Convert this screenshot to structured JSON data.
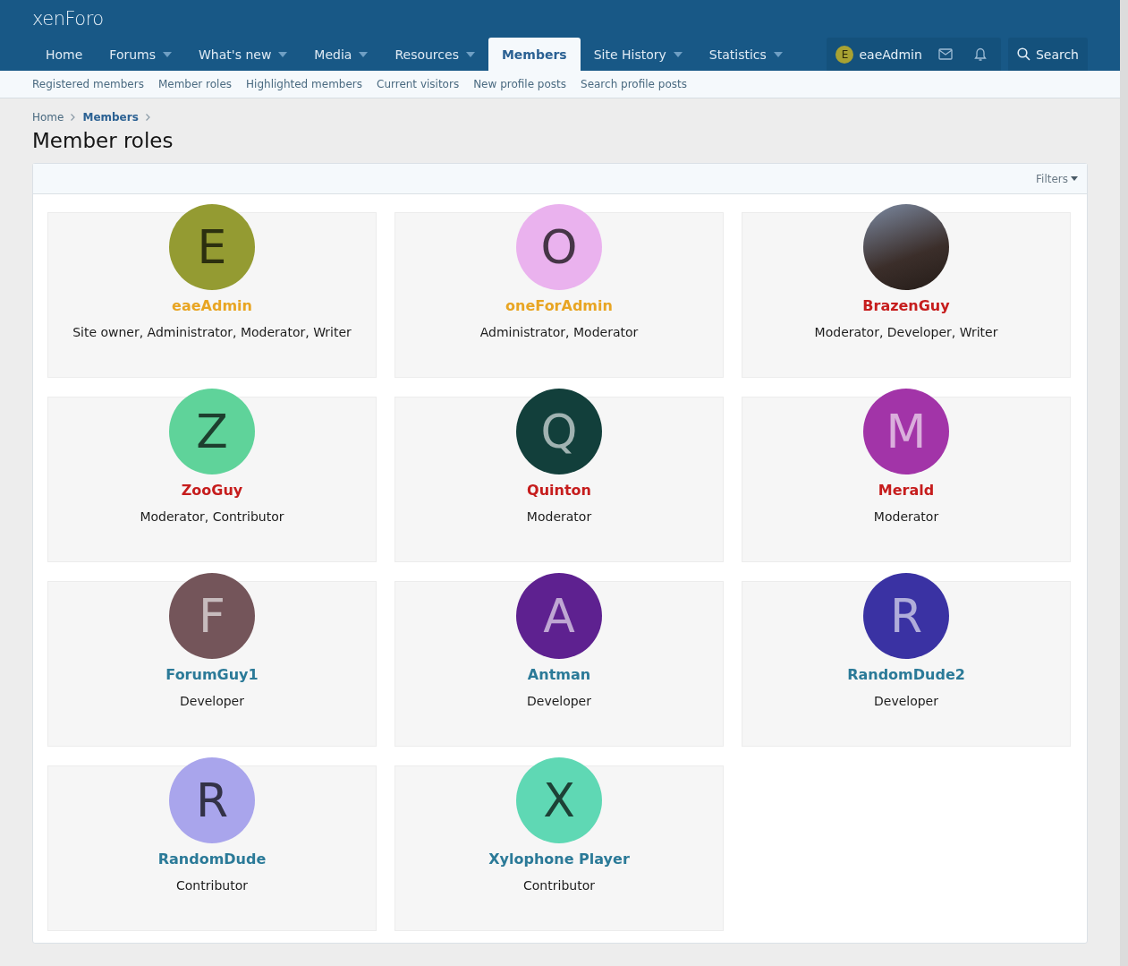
{
  "logo": "xenForo",
  "nav": [
    {
      "label": "Home",
      "dropdown": false,
      "selected": false
    },
    {
      "label": "Forums",
      "dropdown": true,
      "selected": false
    },
    {
      "label": "What's new",
      "dropdown": true,
      "selected": false
    },
    {
      "label": "Media",
      "dropdown": true,
      "selected": false
    },
    {
      "label": "Resources",
      "dropdown": true,
      "selected": false
    },
    {
      "label": "Members",
      "dropdown": false,
      "selected": true
    },
    {
      "label": "Site History",
      "dropdown": true,
      "selected": false
    },
    {
      "label": "Statistics",
      "dropdown": true,
      "selected": false
    }
  ],
  "account": {
    "avatar_letter": "E",
    "name": "eaeAdmin"
  },
  "search": {
    "label": "Search"
  },
  "subnav": [
    {
      "label": "Registered members"
    },
    {
      "label": "Member roles"
    },
    {
      "label": "Highlighted members"
    },
    {
      "label": "Current visitors"
    },
    {
      "label": "New profile posts"
    },
    {
      "label": "Search profile posts"
    }
  ],
  "breadcrumbs": [
    {
      "label": "Home",
      "current": false
    },
    {
      "label": "Members",
      "current": true
    }
  ],
  "title": "Member roles",
  "filters": {
    "label": "Filters"
  },
  "members": [
    {
      "kind": "letter",
      "avatar": {
        "letter": "E",
        "color": "#949b32"
      },
      "name": "eaeAdmin",
      "color": "#e8a523",
      "roles": "Site owner, Administrator, Moderator, Writer"
    },
    {
      "kind": "letter",
      "avatar": {
        "letter": "O",
        "color": "#eab2ee"
      },
      "name": "oneForAdmin",
      "color": "#e8a523",
      "roles": "Administrator, Moderator"
    },
    {
      "kind": "photo",
      "name": "BrazenGuy",
      "color": "#c61d1d",
      "roles": "Moderator, Developer, Writer"
    },
    {
      "kind": "letter",
      "avatar": {
        "letter": "Z",
        "color": "#5fd39a"
      },
      "name": "ZooGuy",
      "color": "#c61d1d",
      "roles": "Moderator, Contributor"
    },
    {
      "kind": "letter",
      "avatar": {
        "letter": "Q",
        "color": "#123f3b"
      },
      "name": "Quinton",
      "color": "#c61d1d",
      "roles": "Moderator"
    },
    {
      "kind": "letter",
      "avatar": {
        "letter": "M",
        "color": "#a234a8"
      },
      "name": "Merald",
      "color": "#c61d1d",
      "roles": "Moderator"
    },
    {
      "kind": "letter",
      "avatar": {
        "letter": "F",
        "color": "#74555a"
      },
      "name": "ForumGuy1",
      "color": "#2b7a98",
      "roles": "Developer"
    },
    {
      "kind": "letter",
      "avatar": {
        "letter": "A",
        "color": "#5e2190"
      },
      "name": "Antman",
      "color": "#2b7a98",
      "roles": "Developer"
    },
    {
      "kind": "letter",
      "avatar": {
        "letter": "R",
        "color": "#3a32a3"
      },
      "name": "RandomDude2",
      "color": "#2b7a98",
      "roles": "Developer"
    },
    {
      "kind": "letter",
      "avatar": {
        "letter": "R",
        "color": "#a9a5ec"
      },
      "name": "RandomDude",
      "color": "#2b7a98",
      "roles": "Contributor"
    },
    {
      "kind": "letter",
      "avatar": {
        "letter": "X",
        "color": "#5fd8b4"
      },
      "name": "Xylophone Player",
      "color": "#2b7a98",
      "roles": "Contributor"
    }
  ]
}
